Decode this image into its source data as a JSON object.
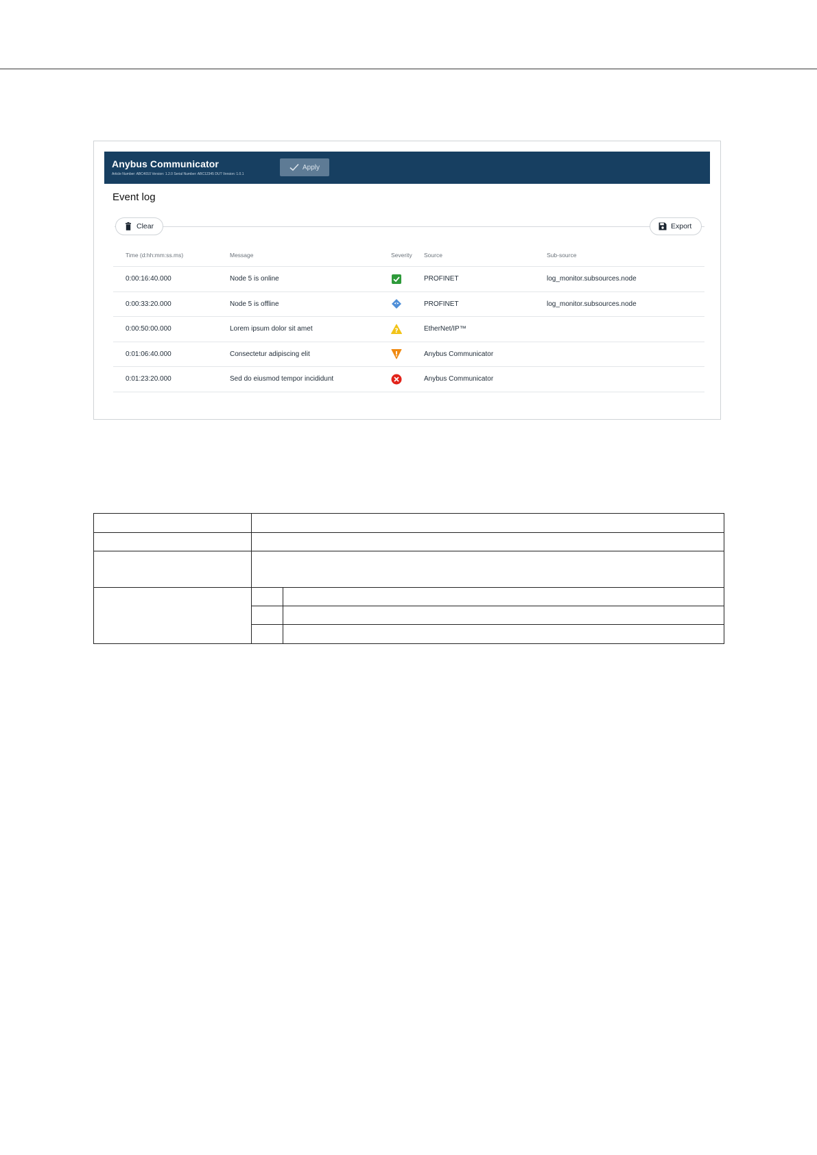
{
  "app": {
    "title": "Anybus Communicator",
    "subtitle": "Article Number: ABC4010 Version: 1.2.0 Serial Number: ABC12345 DUT Version: 1.0.1",
    "apply_label": "Apply"
  },
  "event_log": {
    "title": "Event log",
    "clear_label": "Clear",
    "export_label": "Export",
    "columns": {
      "time": "Time (d:hh:mm:ss.ms)",
      "message": "Message",
      "severity": "Severity",
      "source": "Source",
      "subsource": "Sub-source"
    },
    "rows": [
      {
        "time": "0:00:16:40.000",
        "message": "Node 5 is online",
        "severity": "success-icon",
        "source": "PROFINET",
        "subsource": "log_monitor.subsources.node"
      },
      {
        "time": "0:00:33:20.000",
        "message": "Node 5 is offline",
        "severity": "info-icon",
        "source": "PROFINET",
        "subsource": "log_monitor.subsources.node"
      },
      {
        "time": "0:00:50:00.000",
        "message": "Lorem ipsum dolor sit amet",
        "severity": "warning-icon",
        "source": "EtherNet/IP™",
        "subsource": ""
      },
      {
        "time": "0:01:06:40.000",
        "message": "Consectetur adipiscing elit",
        "severity": "alert-icon",
        "source": "Anybus Communicator",
        "subsource": ""
      },
      {
        "time": "0:01:23:20.000",
        "message": "Sed do eiusmod tempor incididunt",
        "severity": "error-icon",
        "source": "Anybus Communicator",
        "subsource": ""
      }
    ]
  },
  "colors": {
    "header_bg": "#173f61",
    "success": "#2e9a3a",
    "info": "#4f8fd8",
    "warning": "#f2c318",
    "alert": "#f08a12",
    "error": "#e2231a"
  }
}
